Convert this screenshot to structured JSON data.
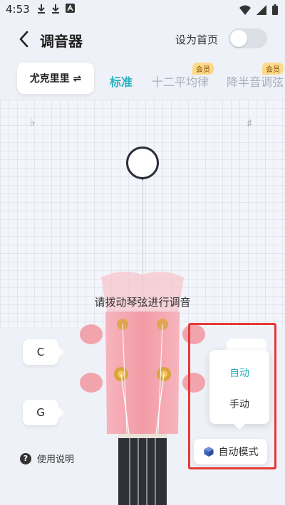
{
  "status": {
    "time": "4:53"
  },
  "header": {
    "title": "调音器",
    "home_label": "设为首页",
    "home_toggle_on": false
  },
  "instrument": {
    "label": "尤克里里 ⇌"
  },
  "tabs": [
    {
      "label": "标准",
      "active": true
    },
    {
      "label": "十二平均律",
      "badge": "会员"
    },
    {
      "label": "降半音调弦",
      "badge": "会员"
    }
  ],
  "tuner": {
    "flat_symbol": "♭",
    "sharp_symbol": "♯",
    "hint": "请拨动琴弦进行调音"
  },
  "strings": {
    "c": "C",
    "g": "G"
  },
  "help": {
    "icon_text": "?",
    "label": "使用说明"
  },
  "mode": {
    "options": [
      "自动",
      "手动"
    ],
    "selected": "自动",
    "button_label": "自动模式"
  },
  "colors": {
    "accent": "#2ab3c2",
    "highlight": "#e53935",
    "ukulele": "#f5a3ad",
    "vip": "#ffd98a"
  }
}
